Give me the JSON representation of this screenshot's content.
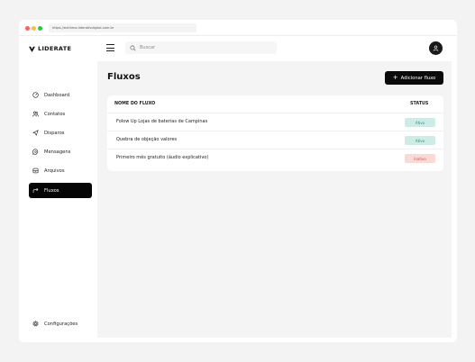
{
  "browser": {
    "url": "https://exthima.liderativdigital.com.br"
  },
  "brand": {
    "name": "LIDERATE"
  },
  "search": {
    "placeholder": "Buscar"
  },
  "sidebar": {
    "items": [
      {
        "label": "Dashboard",
        "icon": "dashboard-icon"
      },
      {
        "label": "Contatos",
        "icon": "users-icon"
      },
      {
        "label": "Disparos",
        "icon": "send-icon"
      },
      {
        "label": "Mensagens",
        "icon": "message-icon"
      },
      {
        "label": "Arquivos",
        "icon": "archive-icon"
      },
      {
        "label": "Fluxos",
        "icon": "flow-icon",
        "active": true
      }
    ],
    "footer": {
      "label": "Configurações",
      "icon": "gear-icon"
    }
  },
  "page": {
    "title": "Fluxos",
    "add_label": "Adicionar fluxo"
  },
  "table": {
    "headers": {
      "name": "NOME DO FLUXO",
      "status": "STATUS"
    },
    "rows": [
      {
        "name": "Folow Up Lojas de baterias de Campinas",
        "status": "Ativo"
      },
      {
        "name": "Quebra de objeção valores",
        "status": "Ativo"
      },
      {
        "name": "Primeiro mês gratuito (áudio explicativo)",
        "status": "Inativo"
      }
    ]
  },
  "colors": {
    "active_badge_bg": "#cdece6",
    "active_badge_text": "#2f8f7a",
    "inactive_badge_bg": "#fbd9d6",
    "inactive_badge_text": "#d9534f",
    "primary": "#0a0a0a"
  }
}
